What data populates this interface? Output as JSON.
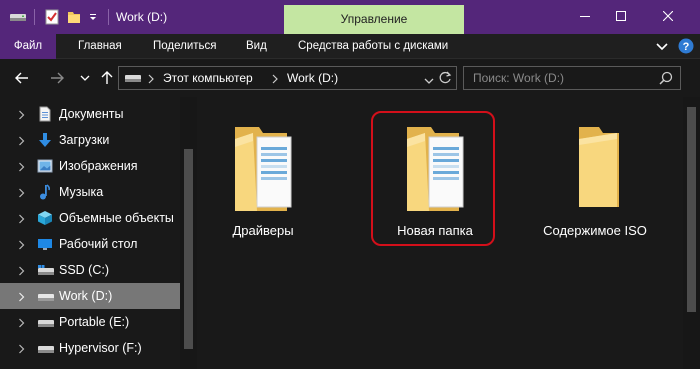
{
  "window": {
    "title": "Work (D:)",
    "context_tab": "Управление"
  },
  "ribbon": {
    "tabs": [
      "Файл",
      "Главная",
      "Поделиться",
      "Вид",
      "Средства работы с дисками"
    ]
  },
  "address": {
    "breadcrumbs": [
      "Этот компьютер",
      "Work (D:)"
    ]
  },
  "search": {
    "placeholder": "Поиск: Work (D:)"
  },
  "sidebar": {
    "items": [
      {
        "label": "Документы",
        "icon": "documents-icon",
        "selected": false
      },
      {
        "label": "Загрузки",
        "icon": "downloads-icon",
        "selected": false
      },
      {
        "label": "Изображения",
        "icon": "pictures-icon",
        "selected": false
      },
      {
        "label": "Музыка",
        "icon": "music-icon",
        "selected": false
      },
      {
        "label": "Объемные объекты",
        "icon": "3d-objects-icon",
        "selected": false
      },
      {
        "label": "Рабочий стол",
        "icon": "desktop-icon",
        "selected": false
      },
      {
        "label": "SSD (C:)",
        "icon": "drive-icon",
        "selected": false
      },
      {
        "label": "Work (D:)",
        "icon": "drive-icon",
        "selected": true
      },
      {
        "label": "Portable (E:)",
        "icon": "drive-icon",
        "selected": false
      },
      {
        "label": "Hypervisor (F:)",
        "icon": "drive-icon",
        "selected": false
      }
    ]
  },
  "content": {
    "items": [
      {
        "label": "Драйверы",
        "icon": "folder-with-files-icon"
      },
      {
        "label": "Новая папка",
        "icon": "folder-with-files-icon",
        "highlighted": true
      },
      {
        "label": "Содержимое ISO",
        "icon": "folder-icon"
      }
    ]
  },
  "colors": {
    "titlebar": "#54267a",
    "context_tab": "#c4e6a2",
    "highlight": "#d30f1a",
    "selected_item": "#777777",
    "background": "#191919"
  }
}
